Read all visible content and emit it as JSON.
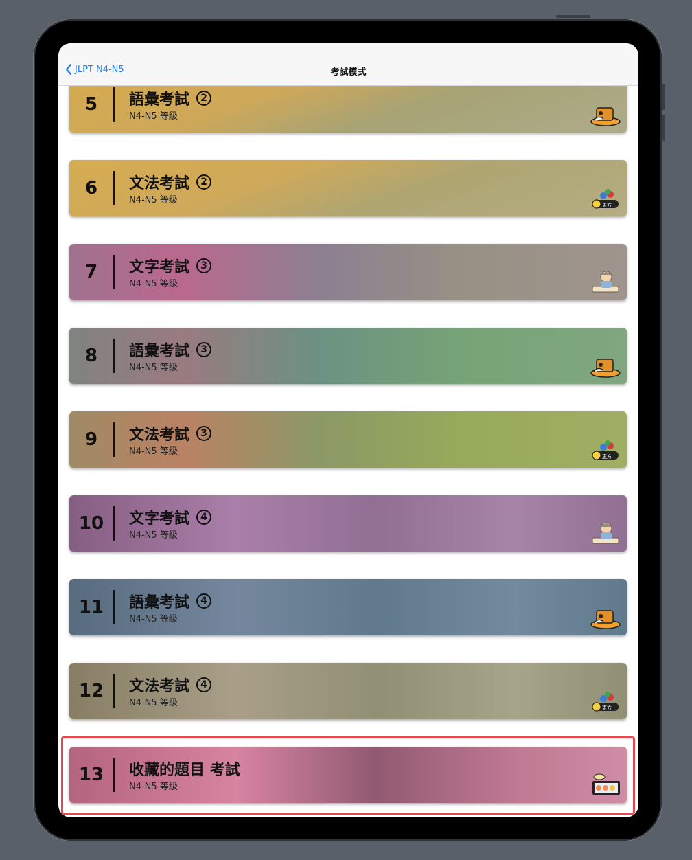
{
  "nav": {
    "back_label": "JLPT N4-N5",
    "title": "考試模式"
  },
  "exams": [
    {
      "number": "5",
      "title": "語彙考試",
      "round": "2",
      "level": "N4-N5 等級",
      "sticker": "clay-pot-icon",
      "theme": "mountain-slope"
    },
    {
      "number": "6",
      "title": "文法考試",
      "round": "2",
      "level": "N4-N5 等級",
      "sticker": "ehomaki-icon",
      "theme": "mountain-slope"
    },
    {
      "number": "7",
      "title": "文字考試",
      "round": "3",
      "level": "N4-N5 等級",
      "sticker": "student-writing-icon",
      "theme": "shrine-lanterns"
    },
    {
      "number": "8",
      "title": "語彙考試",
      "round": "3",
      "level": "N4-N5 等級",
      "sticker": "clay-pot-icon",
      "theme": "shrine-lanterns"
    },
    {
      "number": "9",
      "title": "文法考試",
      "round": "3",
      "level": "N4-N5 等級",
      "sticker": "ehomaki-icon",
      "theme": "shrine-lanterns"
    },
    {
      "number": "10",
      "title": "文字考試",
      "round": "4",
      "level": "N4-N5 等級",
      "sticker": "student-writing-icon",
      "theme": "misty-mountains"
    },
    {
      "number": "11",
      "title": "語彙考試",
      "round": "4",
      "level": "N4-N5 等級",
      "sticker": "clay-pot-icon",
      "theme": "misty-mountains"
    },
    {
      "number": "12",
      "title": "文法考試",
      "round": "4",
      "level": "N4-N5 等級",
      "sticker": "ehomaki-icon",
      "theme": "misty-mountains"
    },
    {
      "number": "13",
      "title": "收藏的題目 考試",
      "round": "",
      "level": "N4-N5 等級",
      "sticker": "sushi-tray-icon",
      "theme": "sakura-temple"
    }
  ],
  "colors": {
    "accent": "#1f7cf2",
    "highlight": "#e8474f"
  }
}
